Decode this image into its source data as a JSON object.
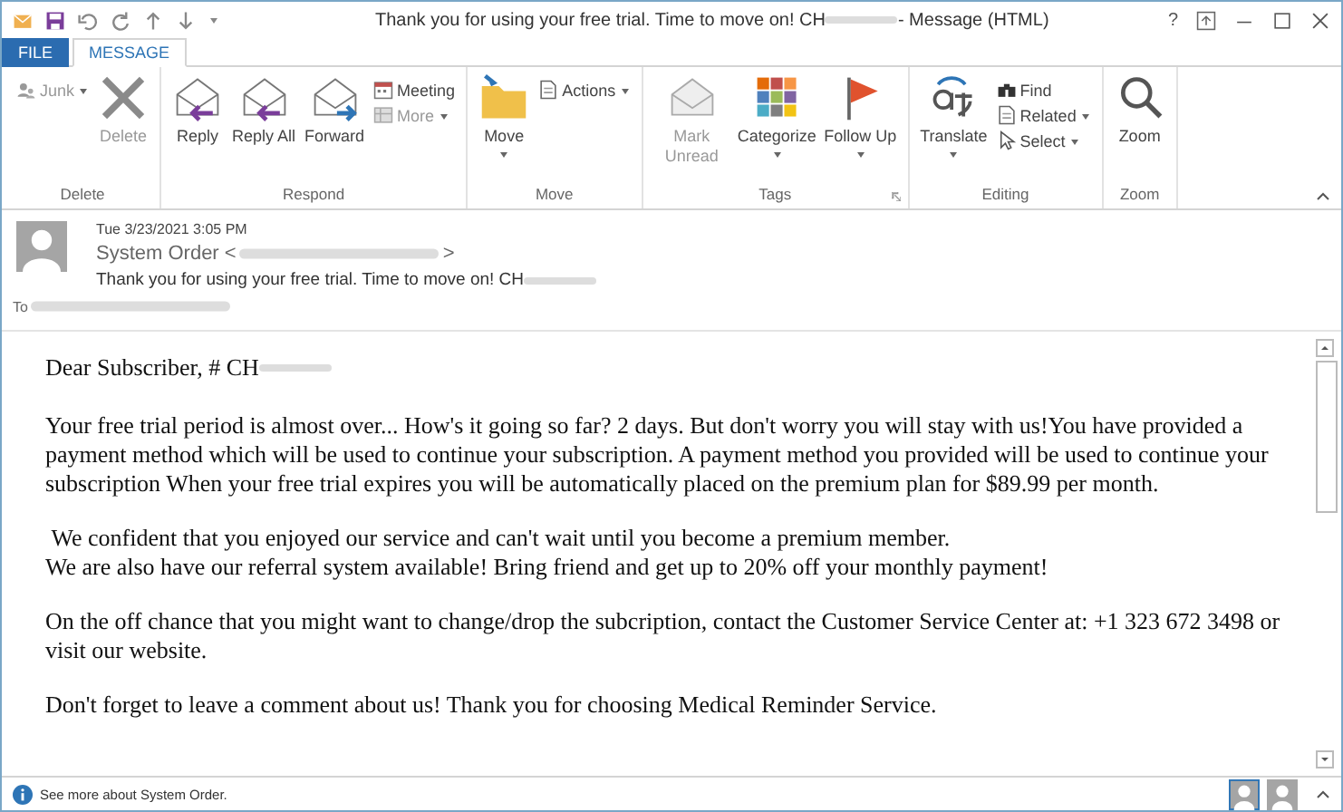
{
  "window": {
    "title": "Thank you for using your free trial. Time to move on! CH",
    "title_suffix": "- Message (HTML)",
    "help": "?"
  },
  "tabs": [
    {
      "label": "FILE",
      "selected": false
    },
    {
      "label": "MESSAGE",
      "selected": true
    }
  ],
  "ribbon": [
    {
      "name": "Delete",
      "commands": [
        {
          "label": "Junk",
          "kind": "small",
          "dropdown": true,
          "disabled": true
        },
        {
          "label": "Delete",
          "kind": "large",
          "dropdown": false,
          "disabled": true
        }
      ]
    },
    {
      "name": "Respond",
      "commands": [
        {
          "label": "Reply",
          "kind": "large",
          "dropdown": false,
          "disabled": false
        },
        {
          "label": "Reply All",
          "kind": "large",
          "dropdown": false,
          "disabled": false
        },
        {
          "label": "Forward",
          "kind": "large",
          "dropdown": false,
          "disabled": false
        },
        {
          "label": "Meeting",
          "kind": "small",
          "dropdown": false,
          "disabled": false
        },
        {
          "label": "More",
          "kind": "small",
          "dropdown": true,
          "disabled": true
        }
      ]
    },
    {
      "name": "Move",
      "commands": [
        {
          "label": "Move",
          "kind": "large",
          "dropdown": true,
          "disabled": false
        },
        {
          "label": "Actions",
          "kind": "small",
          "dropdown": true,
          "disabled": false
        }
      ]
    },
    {
      "name": "Tags",
      "commands": [
        {
          "label": "Mark Unread",
          "kind": "large",
          "dropdown": false,
          "disabled": true
        },
        {
          "label": "Categorize",
          "kind": "large",
          "dropdown": true,
          "disabled": false
        },
        {
          "label": "Follow Up",
          "kind": "large",
          "dropdown": true,
          "disabled": false
        }
      ]
    },
    {
      "name": "Editing",
      "commands": [
        {
          "label": "Translate",
          "kind": "large",
          "dropdown": true,
          "disabled": false
        },
        {
          "label": "Find",
          "kind": "small",
          "dropdown": false,
          "disabled": false
        },
        {
          "label": "Related",
          "kind": "small",
          "dropdown": true,
          "disabled": false
        },
        {
          "label": "Select",
          "kind": "small",
          "dropdown": true,
          "disabled": false
        }
      ]
    },
    {
      "name": "Zoom",
      "commands": [
        {
          "label": "Zoom",
          "kind": "large",
          "dropdown": false,
          "disabled": false
        }
      ]
    }
  ],
  "header": {
    "date": "Tue 3/23/2021 3:05 PM",
    "sender": "System Order <",
    "sender_end": ">",
    "subject": "Thank you for using your free trial. Time to move on! CH",
    "to_label": "To"
  },
  "body": {
    "greeting": "Dear Subscriber, # CH",
    "paragraphs": [
      [
        "Your free trial period is almost over... How's it going so far? 2 days. But don't worry you will stay with us!You have provided a payment method which will be used to continue your subscription. A payment method you provided will be used to continue your subscription When your free trial expires you will be automatically placed on the premium plan for $89.99 per month."
      ],
      [
        " We confident that you enjoyed our service and can't wait until you become a premium member.",
        "We are also have our referral system available! Bring friend and get up to 20% off your monthly payment!"
      ],
      [
        "On the off chance that you might want to change/drop the subcription, contact the Customer Service Center at: +1 323 672 3498 or visit our website."
      ],
      [
        "Don't forget to leave a comment about us! Thank you for choosing Medical Reminder Service."
      ]
    ]
  },
  "status_bar": {
    "text": "See more about System Order."
  }
}
